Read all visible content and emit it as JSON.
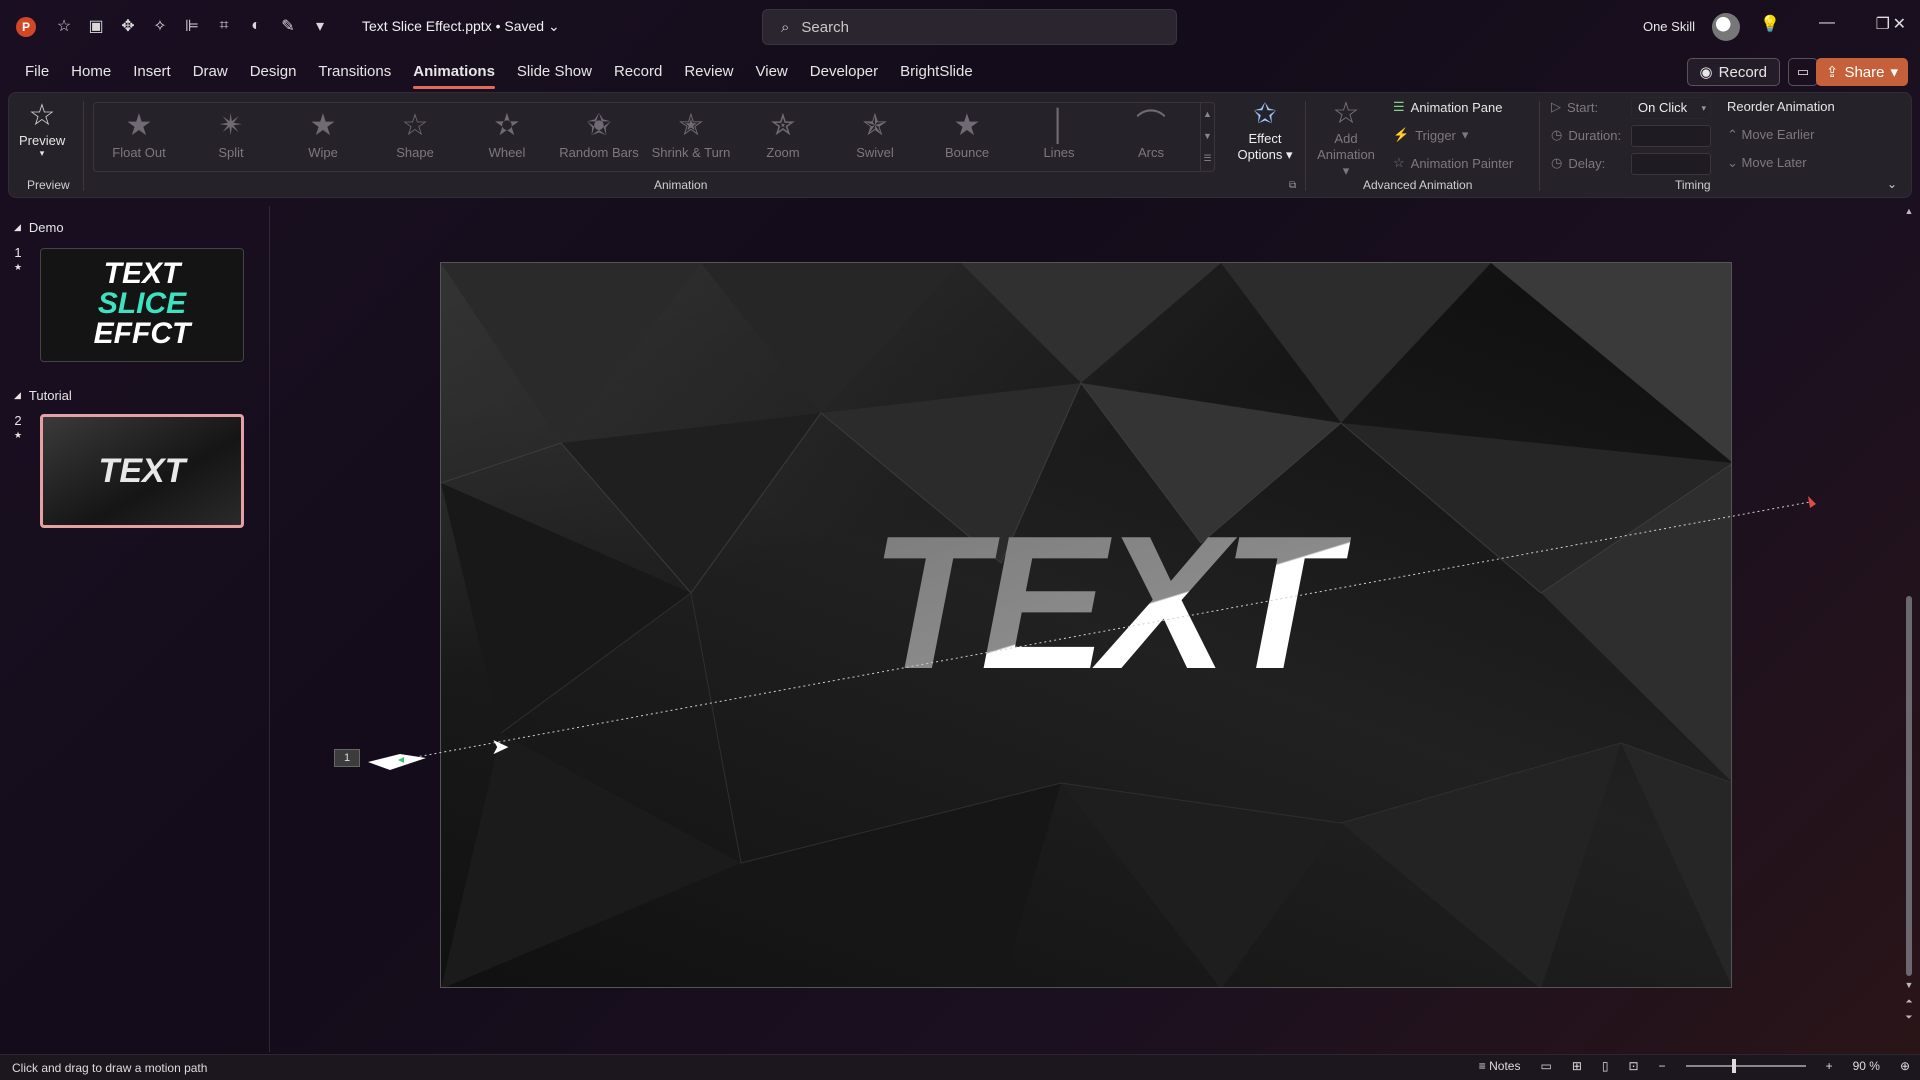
{
  "titlebar": {
    "app_icon": "P",
    "qat_icons": [
      "autosave-icon",
      "picture-icon",
      "move-icon",
      "shape-icon",
      "align-icon",
      "crop-icon",
      "fill-icon",
      "pen-icon",
      "customize-icon"
    ],
    "doc_title": "Text Slice Effect.pptx • Saved",
    "search_placeholder": "Search",
    "user_name": "One Skill"
  },
  "tabs": [
    "File",
    "Home",
    "Insert",
    "Draw",
    "Design",
    "Transitions",
    "Animations",
    "Slide Show",
    "Record",
    "Review",
    "View",
    "Developer",
    "BrightSlide"
  ],
  "active_tab": "Animations",
  "actions": {
    "record": "Record",
    "share": "Share"
  },
  "ribbon": {
    "preview": {
      "label": "Preview",
      "group": "Preview"
    },
    "animation_group": "Animation",
    "animations": [
      "Float Out",
      "Split",
      "Wipe",
      "Shape",
      "Wheel",
      "Random Bars",
      "Shrink & Turn",
      "Zoom",
      "Swivel",
      "Bounce",
      "Lines",
      "Arcs"
    ],
    "effect_options": {
      "line1": "Effect",
      "line2": "Options"
    },
    "add_animation": {
      "line1": "Add",
      "line2": "Animation"
    },
    "advanced": {
      "group": "Advanced Animation",
      "pane": "Animation Pane",
      "trigger": "Trigger",
      "painter": "Animation Painter"
    },
    "timing": {
      "group": "Timing",
      "start_label": "Start:",
      "start_value": "On Click",
      "duration_label": "Duration:",
      "delay_label": "Delay:",
      "reorder_title": "Reorder Animation",
      "move_earlier": "Move Earlier",
      "move_later": "Move Later"
    }
  },
  "panel": {
    "sections": [
      {
        "name": "Demo",
        "slides": [
          {
            "number": "1",
            "lines": [
              "TEXT",
              "SLICE",
              "EFFCT"
            ]
          }
        ]
      },
      {
        "name": "Tutorial",
        "slides": [
          {
            "number": "2",
            "lines": [
              "TEXT"
            ]
          }
        ]
      }
    ]
  },
  "slide": {
    "main_text": "TEXT",
    "animation_tag": "1"
  },
  "status": {
    "hint": "Click and drag to draw a motion path",
    "notes": "Notes",
    "zoom": "90 %"
  },
  "colors": {
    "accent_tab": "#e06b5c",
    "share": "#c5603a",
    "slice_highlight": "#3ee2c0",
    "selected_thumb": "#e5a0a3"
  }
}
